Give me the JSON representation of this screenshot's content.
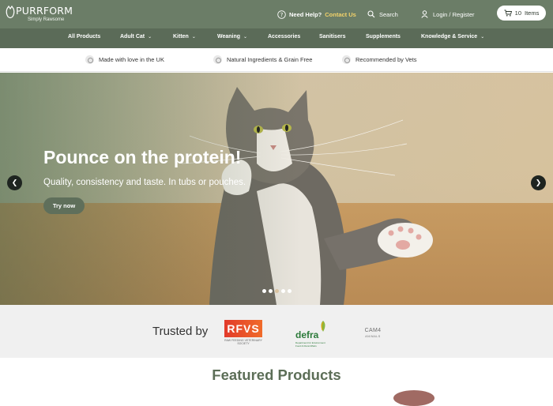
{
  "brand": {
    "name": "PURRFORM",
    "tagline": "Simply Rawsome"
  },
  "topbar": {
    "help_label": "Need Help?",
    "contact_label": "Contact Us",
    "search_label": "Search",
    "login_label": "Login / Register",
    "cart_count": "10",
    "cart_label": "Items"
  },
  "nav": {
    "items": [
      {
        "label": "All Products",
        "has_dropdown": false
      },
      {
        "label": "Adult Cat",
        "has_dropdown": true
      },
      {
        "label": "Kitten",
        "has_dropdown": true
      },
      {
        "label": "Weaning",
        "has_dropdown": true
      },
      {
        "label": "Accessories",
        "has_dropdown": false
      },
      {
        "label": "Sanitisers",
        "has_dropdown": false
      },
      {
        "label": "Supplements",
        "has_dropdown": false
      },
      {
        "label": "Knowledge & Service",
        "has_dropdown": true
      }
    ],
    "chevron": "⌄"
  },
  "usp": {
    "items": [
      {
        "label": "Made with love in the UK",
        "icon": "uk-icon"
      },
      {
        "label": "Natural Ingredients & Grain Free",
        "icon": "leaf-icon"
      },
      {
        "label": "Recommended by Vets",
        "icon": "vet-icon"
      }
    ]
  },
  "hero": {
    "title": "Pounce on the protein!",
    "subtitle": "Quality, consistency and taste. In tubs or pouches.",
    "cta_label": "Try now",
    "prev_glyph": "❮",
    "next_glyph": "❯",
    "slide_count": 5,
    "active_slide": 3
  },
  "trusted": {
    "label": "Trusted by",
    "logos": [
      {
        "name": "RFVS",
        "caption": "RAW FEEDING VETERINARY SOCIETY"
      },
      {
        "name": "defra",
        "caption": "Department for Environment Food & Rural Affairs"
      },
      {
        "name": "CAM4",
        "caption": "ANIMALS"
      }
    ]
  },
  "featured": {
    "title": "Featured Products"
  },
  "colors": {
    "topbar": "#6b7d67",
    "nav": "#5b6b58",
    "accent_contact": "#f3d26a",
    "featured_title": "#5c6e57",
    "cta": "#5f6f5b"
  }
}
